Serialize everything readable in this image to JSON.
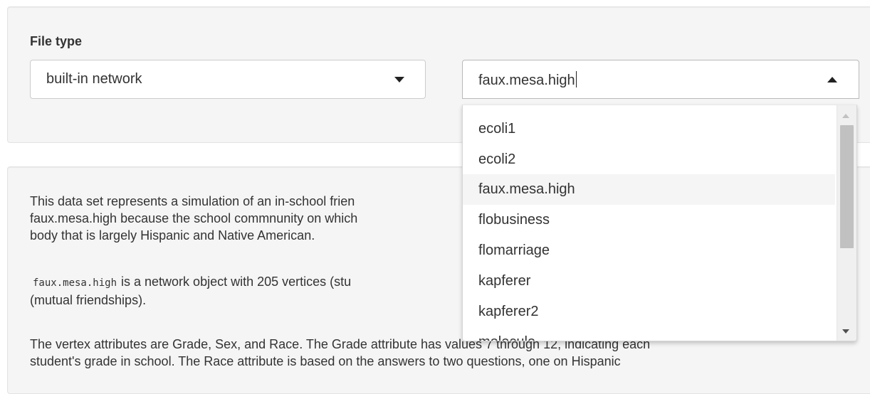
{
  "file_type": {
    "label": "File type",
    "selected": "built-in network",
    "caret_icon": "caret-down-icon"
  },
  "dataset": {
    "input_value": "faux.mesa.high",
    "caret_icon": "caret-up-icon",
    "options": [
      "ecoli1",
      "ecoli2",
      "faux.mesa.high",
      "flobusiness",
      "flomarriage",
      "kapferer",
      "kapferer2",
      "molecule"
    ],
    "highlighted": "faux.mesa.high"
  },
  "description": {
    "p1_line1": "This data set represents a simulation of an in-school frien",
    "p1_line2": "faux.mesa.high because the school commnunity on which",
    "p1_line3": "body that is largely Hispanic and Native American.",
    "p2_code": "faux.mesa.high",
    "p2_line1_rest": "is a network object with 205 vertices (stu",
    "p2_line2": "(mutual friendships).",
    "p3_line1": "The vertex attributes are Grade, Sex, and Race. The Grade attribute has values 7 through 12, indicating each",
    "p3_line2": "student's grade in school. The Race attribute is based on the answers to two questions, one on Hispanic"
  },
  "colors": {
    "panel_bg": "#f5f5f5",
    "highlight_bg": "#f5f5f5",
    "text": "#333333"
  }
}
